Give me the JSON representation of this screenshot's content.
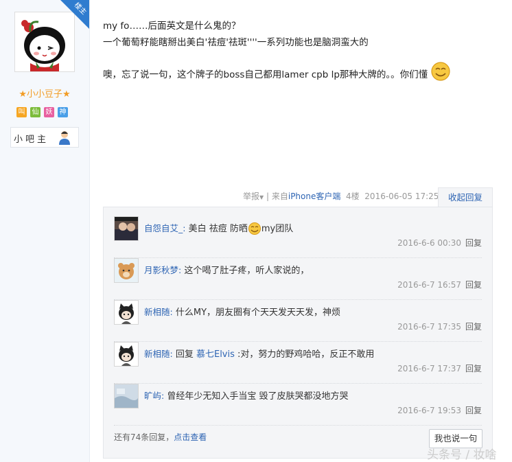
{
  "author": {
    "corner_badge": "楼主",
    "username": "★小小豆子★",
    "badges": [
      {
        "text": "叫",
        "color": "#f6a623"
      },
      {
        "text": "仙",
        "color": "#7cbc3b"
      },
      {
        "text": "妖",
        "color": "#e860a0"
      },
      {
        "text": "神",
        "color": "#4a9fe8"
      }
    ],
    "rank": "小吧主"
  },
  "post": {
    "line1": "my fo……后面英文是什么鬼的？",
    "line2": "一个葡萄籽能瞎掰出美白'祛痘'祛斑''''一系列功能也是脑洞蛮大的",
    "line3": "噢，忘了说一句，这个牌子的boss自己都用lamer cpb lp那种大牌的。。你们懂"
  },
  "meta": {
    "report": "举报",
    "from_prefix": "| 来自",
    "client": "iPhone客户端",
    "floor": "4楼",
    "datetime": "2016-06-05 17:25"
  },
  "fold_label": "收起回复",
  "replies": [
    {
      "name": "自怨自艾_:",
      "text_a": " 美白 祛痘 防晒",
      "text_b": "my团队",
      "time": "2016-6-6 00:30",
      "reply_label": "回复"
    },
    {
      "name": "月影秋梦:",
      "text_a": " 这个喝了肚子疼，听人家说的，",
      "time": "2016-6-7 16:57",
      "reply_label": "回复"
    },
    {
      "name": "新相随:",
      "text_a": " 什么MY，朋友圈有个天天发天天发，神烦",
      "time": "2016-6-7 17:35",
      "reply_label": "回复"
    },
    {
      "name": "新相随:",
      "text_a": " 回复 ",
      "mention": "慕七Elvis",
      "text_b": " :对，努力的野鸡哈哈，反正不敢用",
      "time": "2016-6-7 17:37",
      "reply_label": "回复"
    },
    {
      "name": "旷屿:",
      "text_a": " 曾经年少无知入手当宝 毁了皮肤哭都没地方哭",
      "time": "2016-6-7 19:53",
      "reply_label": "回复"
    }
  ],
  "more": {
    "prefix": "还有74条回复，",
    "link": "点击查看"
  },
  "say_button": "我也说一句",
  "watermark": "头条号 / 妆啥"
}
